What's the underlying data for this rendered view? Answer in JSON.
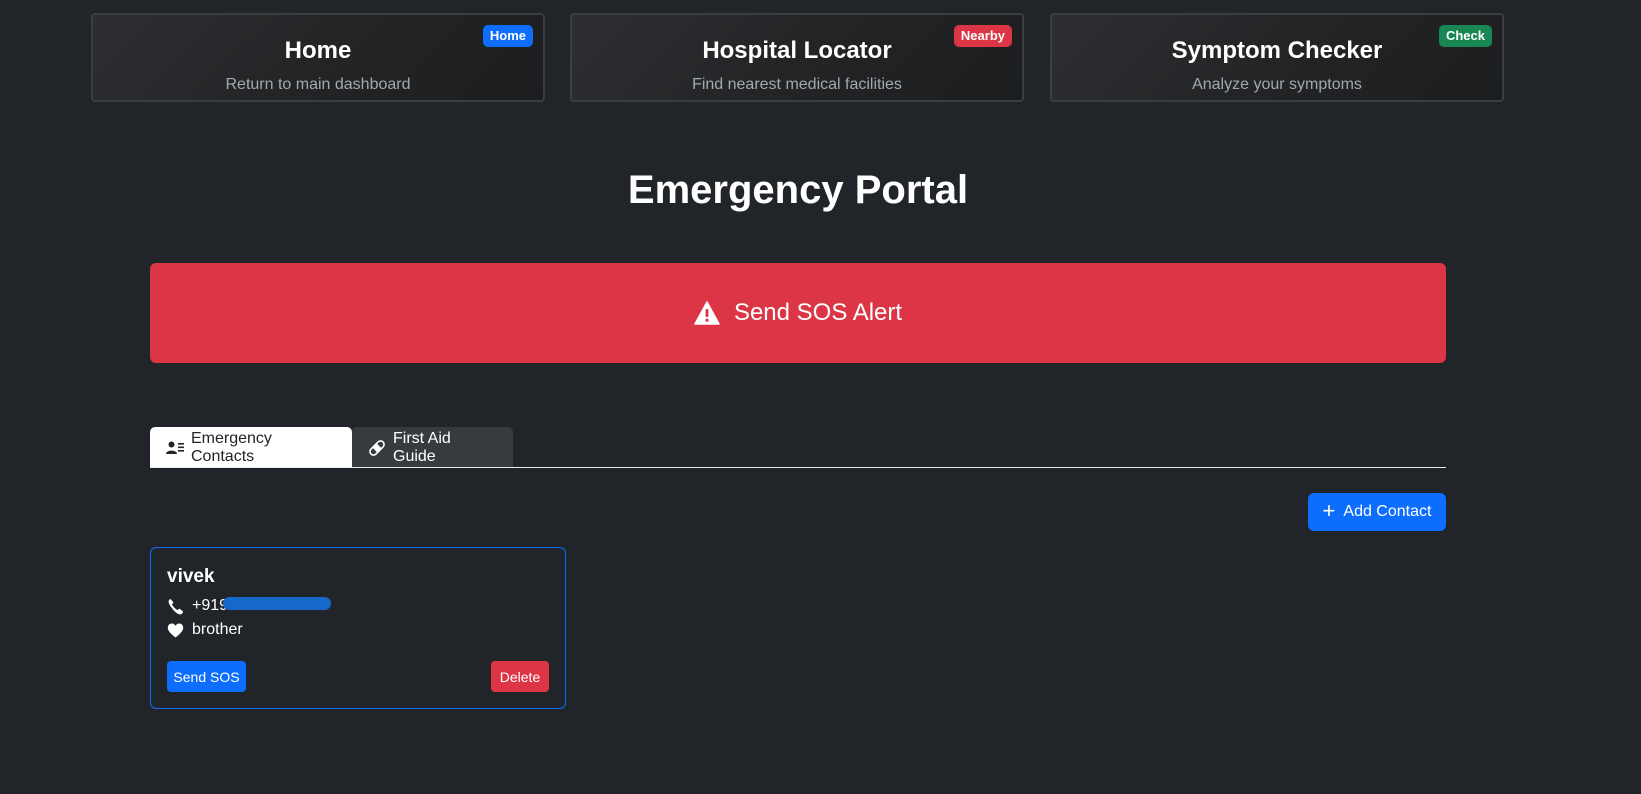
{
  "nav_cards": [
    {
      "title": "Home",
      "subtitle": "Return to main dashboard",
      "badge": "Home",
      "badge_color": "#0d6efd"
    },
    {
      "title": "Hospital Locator",
      "subtitle": "Find nearest medical facilities",
      "badge": "Nearby",
      "badge_color": "#dc3545"
    },
    {
      "title": "Symptom Checker",
      "subtitle": "Analyze your symptoms",
      "badge": "Check",
      "badge_color": "#198754"
    }
  ],
  "page_title": "Emergency Portal",
  "sos": {
    "label": "Send SOS Alert",
    "icon": "warning-triangle-icon",
    "color": "#dc3545"
  },
  "tabs": [
    {
      "label": "Emergency Contacts",
      "icon": "contact-list-icon",
      "active": true
    },
    {
      "label": "First Aid Guide",
      "icon": "bandage-icon",
      "active": false
    }
  ],
  "add_contact": {
    "label": "Add Contact",
    "icon": "plus-icon"
  },
  "contacts": [
    {
      "name": "vivek",
      "phone": "+919518029369",
      "relation": "brother",
      "send_label": "Send SOS",
      "delete_label": "Delete"
    }
  ],
  "colors": {
    "background": "#212529",
    "primary": "#0d6efd",
    "danger": "#dc3545",
    "success": "#198754"
  }
}
